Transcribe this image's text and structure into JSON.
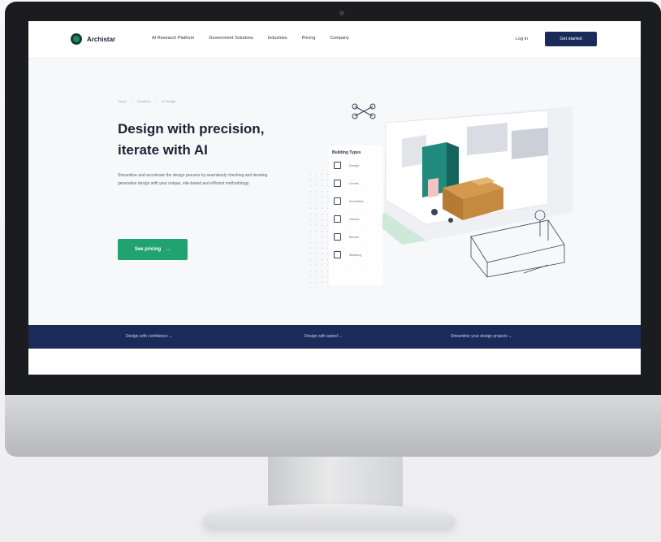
{
  "nav": {
    "brand": "Archistar",
    "links": [
      "AI Research Platform",
      "Government Solutions",
      "Industries",
      "Pricing",
      "Company"
    ],
    "login": "Log in",
    "cta": "Get started"
  },
  "breadcrumb": [
    "Home",
    "Solutions",
    "AI Design"
  ],
  "hero": {
    "title_line1": "Design with precision,",
    "title_line2": "iterate with AI",
    "body": "Streamline and accelerate the design process by seamlessly checking and iterating generative design with your unique, site-based and efficient methodology.",
    "button": "See pricing"
  },
  "panel": {
    "title": "Building Types",
    "items": [
      "Design",
      "Levels",
      "Amenities",
      "Sheets",
      "Blocks",
      "Massing"
    ]
  },
  "band": {
    "items": [
      "Design with confidence",
      "Design with speed",
      "Streamline your design projects"
    ]
  },
  "colors": {
    "navy": "#1b2b59",
    "green": "#21a36f",
    "title": "#1b2233"
  }
}
